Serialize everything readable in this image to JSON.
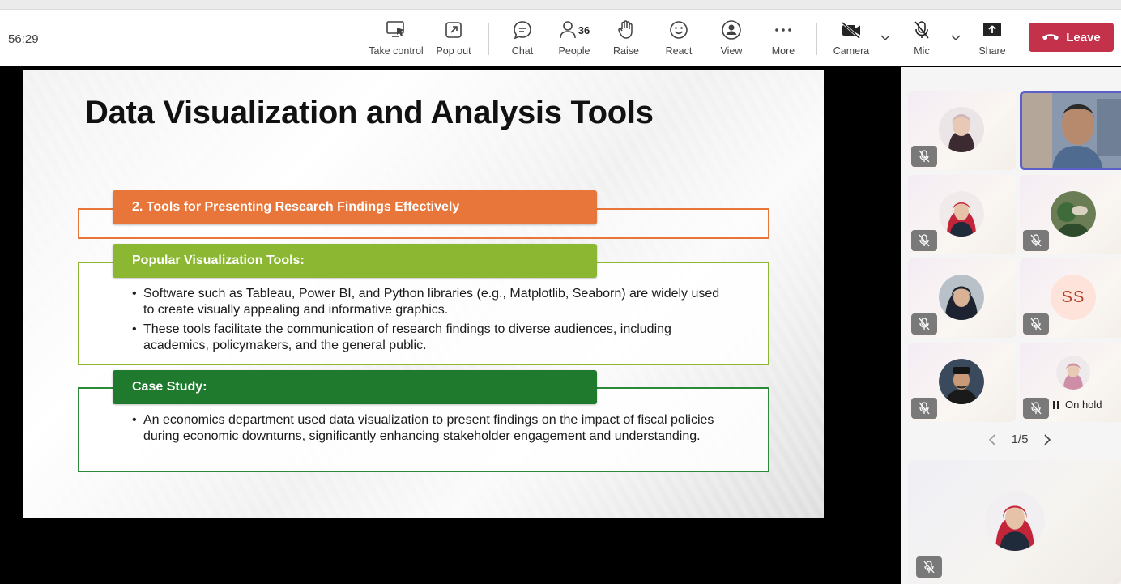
{
  "meeting": {
    "timer": "56:29",
    "toolbar": {
      "take_control": "Take control",
      "pop_out": "Pop out",
      "chat": "Chat",
      "people": "People",
      "people_count": "36",
      "raise": "Raise",
      "react": "React",
      "view": "View",
      "more": "More",
      "camera": "Camera",
      "mic": "Mic",
      "share": "Share",
      "leave": "Leave"
    }
  },
  "slide": {
    "title": "Data Visualization and Analysis Tools",
    "section1": {
      "header": "2. Tools for Presenting Research Findings Effectively"
    },
    "section2": {
      "header": "Popular Visualization Tools:",
      "bullets": [
        "Software such as Tableau, Power BI, and Python libraries (e.g., Matplotlib, Seaborn) are widely used to create visually appealing and informative graphics.",
        "These tools facilitate the communication of research findings to diverse audiences, including academics, policymakers, and the general public."
      ]
    },
    "section3": {
      "header": "Case Study:",
      "bullets": [
        "An economics department used data visualization to present findings on the impact of fiscal policies during economic downturns, significantly enhancing stakeholder engagement and understanding."
      ]
    }
  },
  "participants": {
    "tile_ss_initials": "SS",
    "on_hold_label": "On hold",
    "pager": "1/5"
  },
  "colors": {
    "orange": "#e8763a",
    "lime": "#8bb733",
    "green": "#1f7a2e",
    "leave": "#c4314b"
  }
}
